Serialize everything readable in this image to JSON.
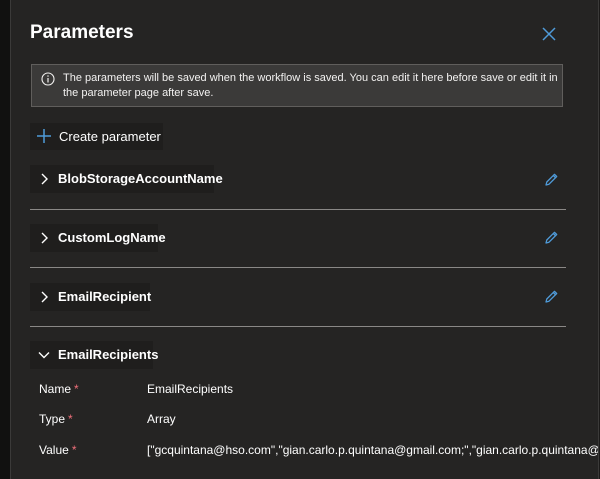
{
  "panel": {
    "title": "Parameters",
    "info_message": "The parameters will be saved when the workflow is saved. You can edit it here before save or edit it in the parameter page after save.",
    "create_button_label": "Create parameter"
  },
  "parameters": [
    {
      "name": "BlobStorageAccountName",
      "expanded": false
    },
    {
      "name": "CustomLogName",
      "expanded": false
    },
    {
      "name": "EmailRecipient",
      "expanded": false
    },
    {
      "name": "EmailRecipients",
      "expanded": true
    }
  ],
  "expanded_detail": {
    "name_label": "Name",
    "name_value": "EmailRecipients",
    "type_label": "Type",
    "type_value": "Array",
    "value_label": "Value",
    "value_value": "[\"gcquintana@hso.com\",\"gian.carlo.p.quintana@gmail.com;\",\"gian.carlo.p.quintana@ou",
    "required_marker": "*"
  },
  "icons": {
    "close": "close-icon",
    "info": "info-icon",
    "add": "plus-icon",
    "collapsed": "chevron-right-icon",
    "expanded": "chevron-down-icon",
    "edit": "pencil-icon"
  },
  "colors": {
    "panel_bg": "#252423",
    "accent": "#4f9bd9",
    "required": "#f1707b",
    "banner_bg": "#3b3a39"
  }
}
